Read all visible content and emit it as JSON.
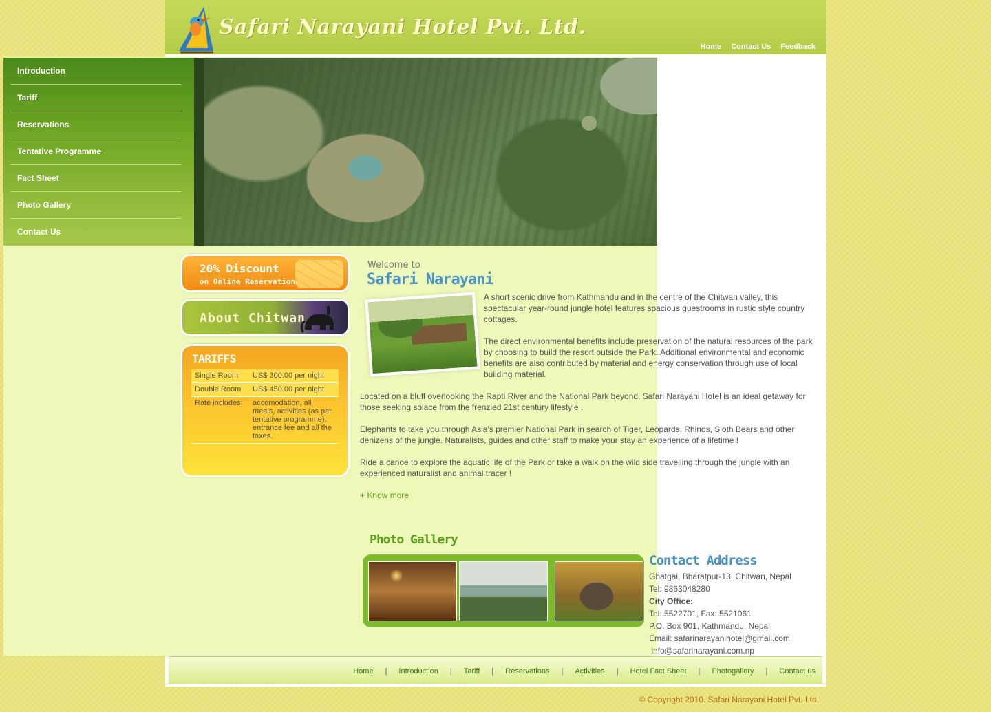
{
  "header": {
    "logo_text": "Safari Narayani Hotel Pvt. Ltd.",
    "top_nav": [
      "Home",
      "Contact Us",
      "Feedback"
    ]
  },
  "sidebar": {
    "items": [
      {
        "label": "Introduction"
      },
      {
        "label": "Tariff"
      },
      {
        "label": "Reservations"
      },
      {
        "label": "Tentative Programme"
      },
      {
        "label": "Fact Sheet"
      },
      {
        "label": "Photo Gallery"
      },
      {
        "label": "Contact Us"
      }
    ]
  },
  "banners": {
    "discount_line1": "20% Discount",
    "discount_line2": "on Online Reservation",
    "chitwan": "About Chitwan"
  },
  "tariffs": {
    "title": "TARIFFS",
    "rows": [
      {
        "label": "Single Room",
        "value": "US$ 300.00 per night"
      },
      {
        "label": "Double Room",
        "value": "US$ 450.00 per night"
      },
      {
        "label": "Rate includes:",
        "value": "accomodation, all meals, activities (as per tentative programme), entrance fee and all the taxes."
      }
    ]
  },
  "welcome": {
    "small": "Welcome to",
    "big": "Safari Narayani",
    "paragraphs": [
      "A short scenic drive from Kathmandu and in the centre of the Chitwan valley, this spectacular year-round jungle hotel features spacious guestrooms in rustic style country cottages.",
      "The direct environmental benefits include preservation of the natural resources of the park by choosing to build the resort outside the Park. Additional environmental and economic benefits are also contributed by material and energy conservation through use of local building material.",
      "Located on a bluff overlooking the Rapti River and the National Park beyond, Safari Narayani Hotel is an ideal getaway for those seeking solace from the frenzied 21st century lifestyle .",
      "Elephants to take you through Asia's premier National Park in search of Tiger, Leopards, Rhinos, Sloth Bears and other denizens of the jungle. Naturalists, guides and other staff to make your stay an experience of a lifetime !",
      "Ride a canoe to explore the aquatic life of the Park or take a walk on the wild side travelling through the jungle with an experienced naturalist and animal tracer !"
    ],
    "know_more": "+ Know more"
  },
  "gallery": {
    "title": "Photo Gallery"
  },
  "contact": {
    "title": "Contact Address",
    "lines": [
      "Ghatgai, Bharatpur-13, Chitwan, Nepal",
      "Tel: 9863048280",
      "City Office:",
      "Tel: 5522701, Fax: 5521061",
      "P.O. Box 901, Kathmandu, Nepal",
      "Email: safarinarayanihotel@gmail.com,",
      " info@safarinarayani.com.np"
    ]
  },
  "footer": {
    "nav": [
      "Home",
      "Introduction",
      "Tariff",
      "Reservations",
      "Activities",
      "Hotel Fact Sheet",
      "Photogallery",
      "Contact us"
    ],
    "separator": "|",
    "copyright": "© Copyright 2010. Safari Narayani Hotel Pvt. Ltd."
  },
  "colors": {
    "header_green": "#b3cc47",
    "nav_green": "#4a8a1a",
    "link_green": "#5a9a1a",
    "heading_blue": "#4a93c7",
    "tariff_orange": "#f5a623",
    "copyright_orange": "#b56a1a"
  },
  "icons": {
    "logo": "kingfisher-bird-logo",
    "chitwan_banner": "elephant-icon"
  }
}
